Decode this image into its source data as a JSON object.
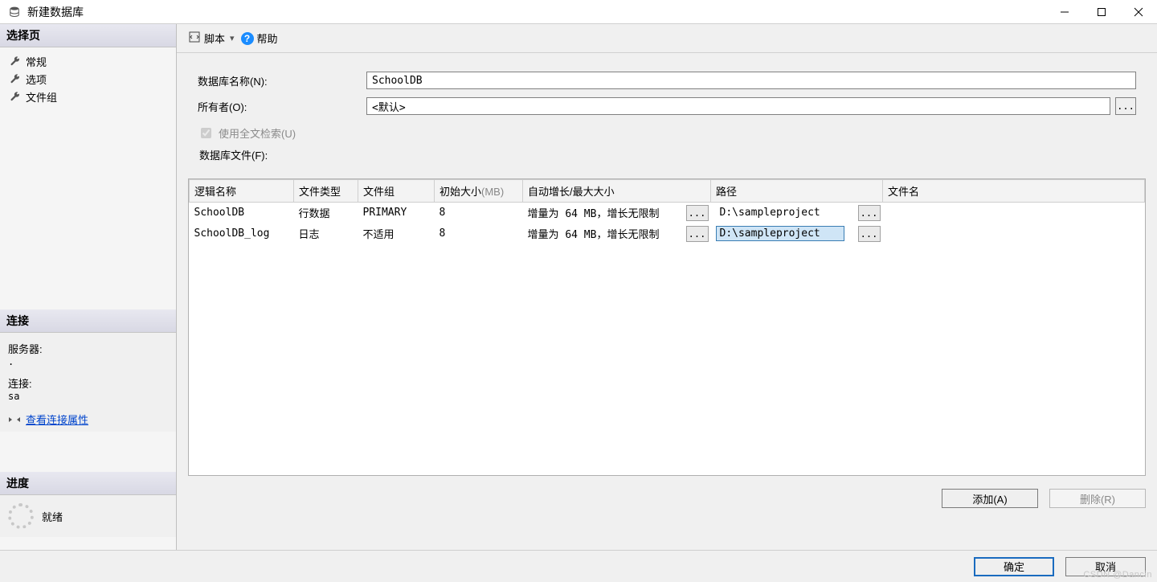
{
  "window": {
    "title": "新建数据库"
  },
  "left": {
    "select_page": {
      "header": "选择页",
      "items": [
        {
          "label": "常规",
          "name": "nav-general"
        },
        {
          "label": "选项",
          "name": "nav-options"
        },
        {
          "label": "文件组",
          "name": "nav-filegroups"
        }
      ]
    },
    "connection": {
      "header": "连接",
      "server_label": "服务器:",
      "server_value": ".",
      "connect_label": "连接:",
      "connect_value": "sa",
      "view_props_link": "查看连接属性"
    },
    "progress": {
      "header": "进度",
      "status": "就绪"
    }
  },
  "toolbar": {
    "script_label": "脚本",
    "help_label": "帮助"
  },
  "form": {
    "db_name_label": "数据库名称(N):",
    "db_name_value": "SchoolDB",
    "owner_label": "所有者(O):",
    "owner_value": "<默认>",
    "owner_browse": "...",
    "fulltext_label": "使用全文检索(U)",
    "fulltext_checked": true,
    "fulltext_disabled": true,
    "files_label": "数据库文件(F):"
  },
  "grid": {
    "columns": {
      "logical_name": "逻辑名称",
      "file_type": "文件类型",
      "filegroup": "文件组",
      "initial_size_prefix": "初始大小",
      "initial_size_unit": "(MB)",
      "autogrowth": "自动增长/最大大小",
      "path": "路径",
      "filename": "文件名"
    },
    "rows": [
      {
        "logical_name": "SchoolDB",
        "file_type": "行数据",
        "filegroup": "PRIMARY",
        "initial_size": "8",
        "autogrowth": "增量为 64 MB，增长无限制",
        "autogrowth_btn": "...",
        "path": "D:\\sampleproject",
        "path_btn": "...",
        "path_selected": false,
        "filename": ""
      },
      {
        "logical_name": "SchoolDB_log",
        "file_type": "日志",
        "filegroup": "不适用",
        "initial_size": "8",
        "autogrowth": "增量为 64 MB，增长无限制",
        "autogrowth_btn": "...",
        "path": "D:\\sampleproject",
        "path_btn": "...",
        "path_selected": true,
        "filename": ""
      }
    ]
  },
  "buttons": {
    "add": "添加(A)",
    "remove": "删除(R)",
    "remove_disabled": true,
    "ok": "确定",
    "cancel": "取消"
  },
  "watermark": "CSDN @Dancin"
}
